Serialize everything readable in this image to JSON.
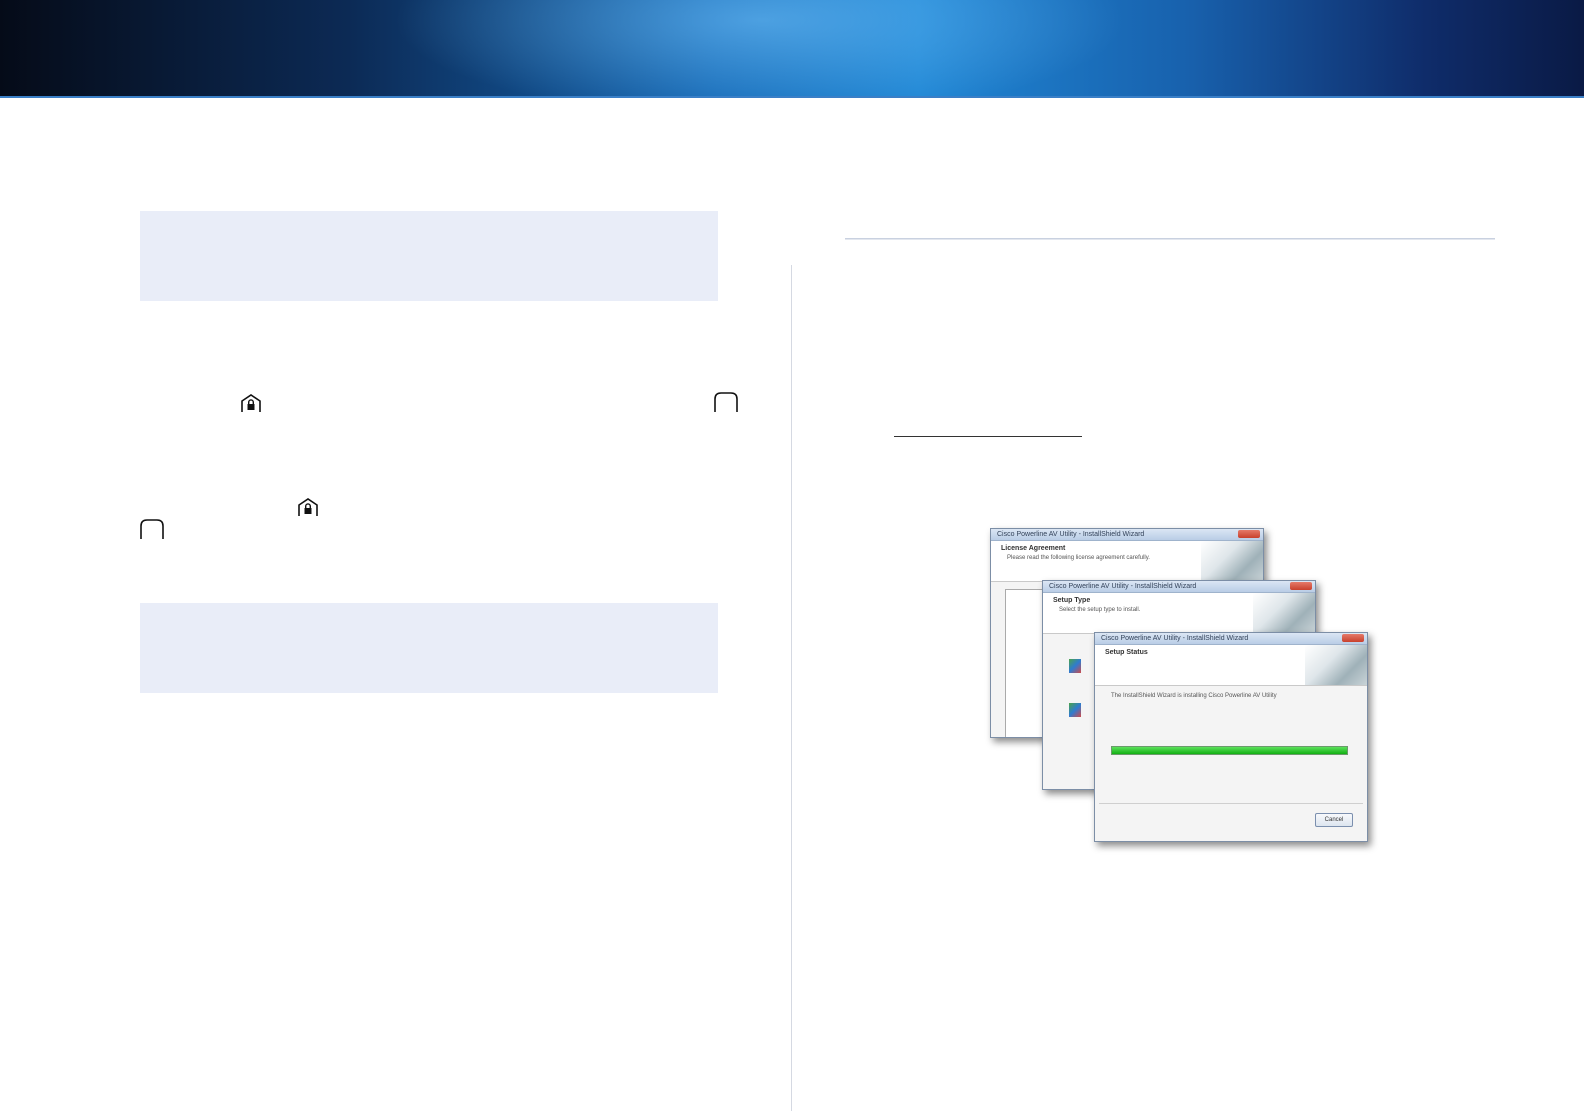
{
  "wizard": {
    "window_1": {
      "title": "Cisco Powerline AV Utility - InstallShield Wizard",
      "heading": "License Agreement",
      "subheading": "Please read the following license agreement carefully."
    },
    "window_2": {
      "title": "Cisco Powerline AV Utility - InstallShield Wizard",
      "heading": "Setup Type",
      "subheading": "Select the setup type to install."
    },
    "window_3": {
      "title": "Cisco Powerline AV Utility - InstallShield Wizard",
      "heading": "Setup Status",
      "status_text": "The InstallShield Wizard is installing Cisco Powerline AV Utility",
      "progress": 1.0,
      "cancel_label": "Cancel"
    }
  },
  "colors": {
    "note_background": "#e9edf8",
    "progress_green": "#1ebf1e"
  }
}
